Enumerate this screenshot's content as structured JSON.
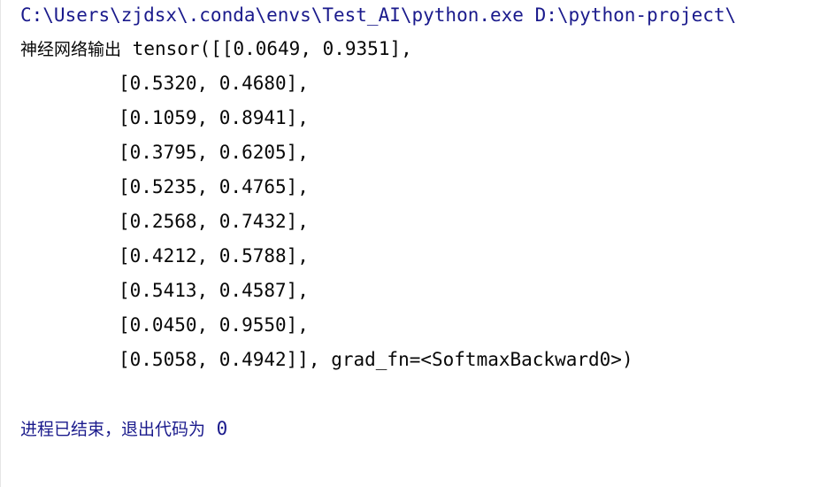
{
  "console": {
    "command_line": "C:\\Users\\zjdsx\\.conda\\envs\\Test_AI\\python.exe D:\\python-project\\",
    "output_label": "神经网络输出",
    "tensor_lines": [
      "tensor([[0.0649, 0.9351],",
      "[0.5320, 0.4680],",
      "[0.1059, 0.8941],",
      "[0.3795, 0.6205],",
      "[0.5235, 0.4765],",
      "[0.2568, 0.7432],",
      "[0.4212, 0.5788],",
      "[0.5413, 0.4587],",
      "[0.0450, 0.9550],",
      "[0.5058, 0.4942]], grad_fn=<SoftmaxBackward0>)"
    ],
    "exit_message": "进程已结束，退出代码为",
    "exit_code": "0"
  }
}
